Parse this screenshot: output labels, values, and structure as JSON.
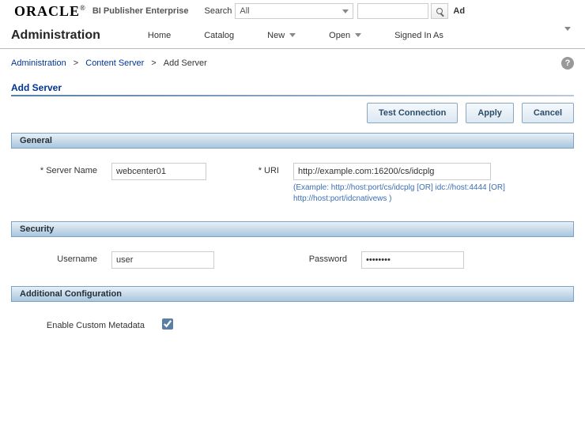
{
  "top": {
    "logo": "ORACLE",
    "product": "BI Publisher Enterprise",
    "search_label": "Search",
    "search_scope": "All",
    "right_cut": "Ad"
  },
  "nav": {
    "title": "Administration",
    "home": "Home",
    "catalog": "Catalog",
    "new": "New",
    "open": "Open",
    "signed": "Signed In As"
  },
  "breadcrumb": {
    "a": "Administration",
    "b": "Content Server",
    "c": "Add Server"
  },
  "page_title": "Add Server",
  "buttons": {
    "test": "Test Connection",
    "apply": "Apply",
    "cancel": "Cancel"
  },
  "sections": {
    "general": "General",
    "security": "Security",
    "additional": "Additional Configuration"
  },
  "fields": {
    "server_name_label": "Server Name",
    "server_name_value": "webcenter01",
    "uri_label": "URI",
    "uri_value": "http://example.com:16200/cs/idcplg",
    "uri_hint": "(Example: http://host:port/cs/idcplg [OR] idc://host:4444 [OR] http://host:port/idcnativews )",
    "username_label": "Username",
    "username_value": "user",
    "password_label": "Password",
    "password_value": "password",
    "enable_meta_label": "Enable Custom Metadata",
    "enable_meta_checked": true
  }
}
